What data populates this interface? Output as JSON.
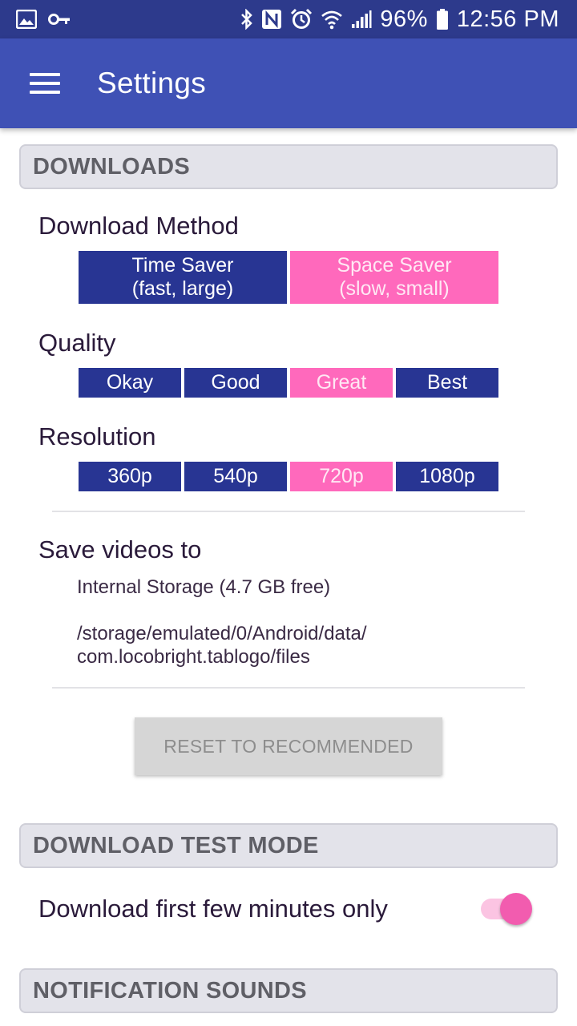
{
  "status_bar": {
    "battery": "96%",
    "time": "12:56 PM",
    "icons": [
      "image-icon",
      "key-icon",
      "bluetooth-icon",
      "nfc-icon",
      "alarm-icon",
      "wifi-icon",
      "signal-icon",
      "battery-icon"
    ]
  },
  "app_bar": {
    "title": "Settings",
    "menu_icon": "hamburger-menu-icon",
    "color": "#3f51b5"
  },
  "downloads": {
    "header": "DOWNLOADS",
    "download_method": {
      "label": "Download Method",
      "options": [
        {
          "line1": "Time Saver",
          "line2": "(fast, large)",
          "selected": false
        },
        {
          "line1": "Space Saver",
          "line2": "(slow, small)",
          "selected": true
        }
      ]
    },
    "quality": {
      "label": "Quality",
      "options": [
        "Okay",
        "Good",
        "Great",
        "Best"
      ],
      "selected": "Great"
    },
    "resolution": {
      "label": "Resolution",
      "options": [
        "360p",
        "540p",
        "720p",
        "1080p"
      ],
      "selected": "720p"
    },
    "save_videos": {
      "label": "Save videos to",
      "storage": "Internal Storage (4.7 GB free)",
      "path_line1": "/storage/emulated/0/Android/data/",
      "path_line2": "com.locobright.tablogo/files"
    },
    "reset_button": "RESET TO RECOMMENDED"
  },
  "download_test_mode": {
    "header": "DOWNLOAD TEST MODE",
    "toggle_label": "Download first few minutes only",
    "toggle_on": true
  },
  "notification_sounds": {
    "header": "NOTIFICATION SOUNDS"
  },
  "colors": {
    "segment_default": "#283593",
    "segment_selected": "#ff69bc",
    "toggle_thumb": "#f25caf"
  }
}
